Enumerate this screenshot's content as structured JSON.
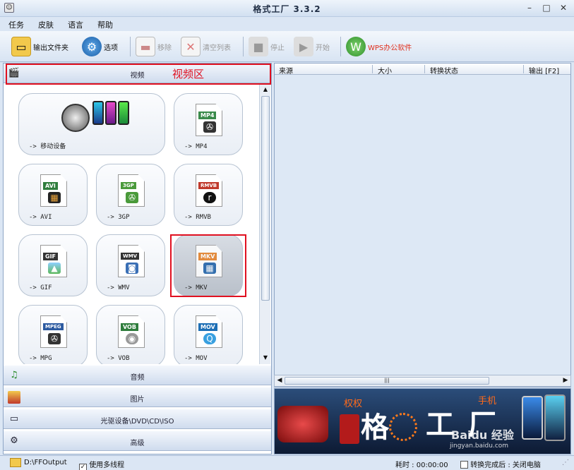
{
  "window": {
    "title": "格式工厂 3.3.2",
    "minimize": "–",
    "maximize": "□",
    "close": "✕"
  },
  "menu": [
    "任务",
    "皮肤",
    "语言",
    "帮助"
  ],
  "toolbar": {
    "output_folder": "输出文件夹",
    "options": "选项",
    "remove": "移除",
    "clear_list": "清空列表",
    "stop": "停止",
    "start": "开始",
    "wps": "WPS办公软件"
  },
  "categories": {
    "video": "视频",
    "audio": "音频",
    "image": "图片",
    "rom": "光驱设备\\DVD\\CD\\ISO",
    "advanced": "高级"
  },
  "annotation": {
    "video_area": "视频区"
  },
  "tiles": [
    {
      "label": "-> 移动设备",
      "badge": ""
    },
    {
      "label": "-> MP4",
      "badge": "MP4"
    },
    {
      "label": "-> AVI",
      "badge": "AVI"
    },
    {
      "label": "-> 3GP",
      "badge": "3GP"
    },
    {
      "label": "-> RMVB",
      "badge": "RMVB"
    },
    {
      "label": "-> GIF",
      "badge": "GIF"
    },
    {
      "label": "-> WMV",
      "badge": "WMV"
    },
    {
      "label": "-> MKV",
      "badge": "MKV"
    },
    {
      "label": "-> MPG",
      "badge": "MPEG"
    },
    {
      "label": "-> VOB",
      "badge": "VOB"
    },
    {
      "label": "-> MOV",
      "badge": "MOV"
    }
  ],
  "columns": {
    "source": "来源",
    "size": "大小",
    "status": "转换状态",
    "output": "输出 [F2]"
  },
  "hscroll_grip": "|||",
  "banner": {
    "big1": "格",
    "big2": "工",
    "big3": "厂",
    "small1": "权权",
    "small2": "手机",
    "watermark": "Baidu 经验",
    "watermark_url": "jingyan.baidu.com"
  },
  "status": {
    "output_path": "D:\\FFOutput",
    "multithread_label": "使用多线程",
    "multithread_checked": "✓",
    "elapsed": "耗时 : 00:00:00",
    "after_convert": "转换完成后 : 关闭电脑"
  },
  "colors": {
    "accent": "#e01020",
    "header_bg": "#dbe6f4",
    "badge_avi": "#2f7d3c",
    "badge_rmvb": "#c0392b",
    "badge_mkv": "#e67e22",
    "badge_mov": "#1e6fb5"
  }
}
